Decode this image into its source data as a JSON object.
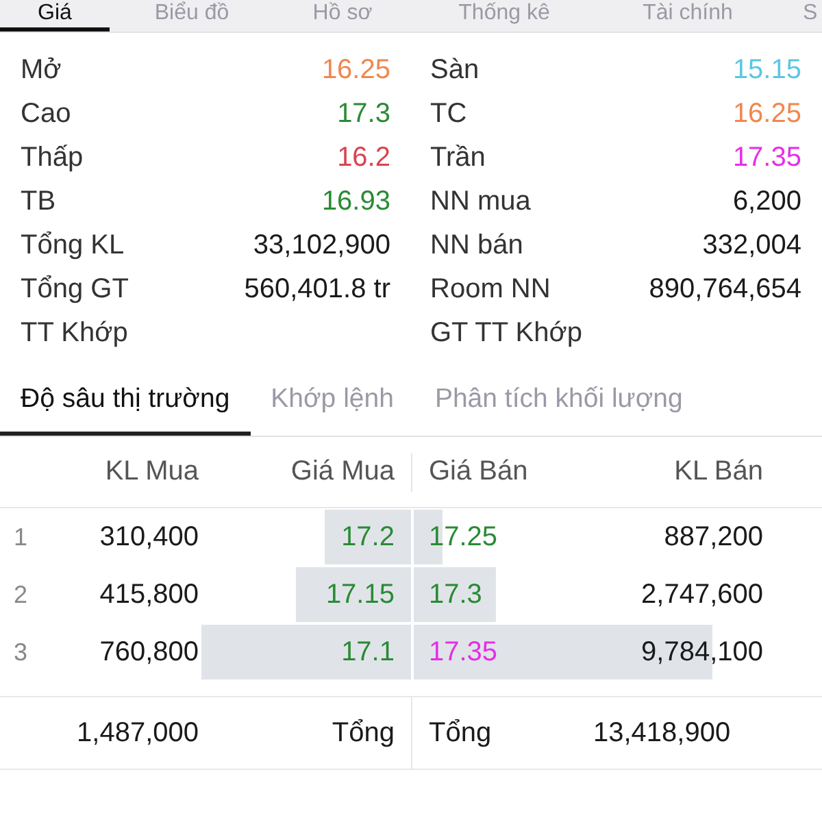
{
  "tabs": [
    {
      "label": "Giá",
      "selected": true
    },
    {
      "label": "Biểu đồ",
      "selected": false
    },
    {
      "label": "Hồ sơ",
      "selected": false
    },
    {
      "label": "Thống kê",
      "selected": false
    },
    {
      "label": "Tài chính",
      "selected": false
    },
    {
      "label": "S",
      "selected": false
    }
  ],
  "stats": {
    "left": [
      {
        "label": "Mở",
        "value": "16.25",
        "color": "#f0874f"
      },
      {
        "label": "Cao",
        "value": "17.3",
        "color": "#2a8a34"
      },
      {
        "label": "Thấp",
        "value": "16.2",
        "color": "#d9434f"
      },
      {
        "label": "TB",
        "value": "16.93",
        "color": "#2a8a34"
      },
      {
        "label": "Tổng KL",
        "value": "33,102,900",
        "color": "#1a1a1a"
      },
      {
        "label": "Tổng GT",
        "value": "560,401.8 tr",
        "color": "#1a1a1a"
      },
      {
        "label": "TT Khớp"
      }
    ],
    "right": [
      {
        "label": "Sàn",
        "value": "15.15",
        "color": "#5cc6e3"
      },
      {
        "label": "TC",
        "value": "16.25",
        "color": "#f0874f"
      },
      {
        "label": "Trần",
        "value": "17.35",
        "color": "#e62ee6"
      },
      {
        "label": "NN mua",
        "value": "6,200",
        "color": "#1a1a1a"
      },
      {
        "label": "NN bán",
        "value": "332,004",
        "color": "#1a1a1a"
      },
      {
        "label": "Room NN",
        "value": "890,764,654",
        "color": "#1a1a1a"
      },
      {
        "label": "GT TT Khớp"
      }
    ]
  },
  "depth_tabs": [
    {
      "label": "Độ sâu thị trường",
      "selected": true
    },
    {
      "label": "Khớp lệnh",
      "selected": false
    },
    {
      "label": "Phân tích khối lượng",
      "selected": false
    }
  ],
  "order_book": {
    "columns": [
      "KL Mua",
      "Giá Mua",
      "Giá Bán",
      "KL Bán"
    ],
    "rows": [
      {
        "number": "1",
        "bid": {
          "volume": "310,400",
          "price": "17.2",
          "color": "#2a8a34",
          "level": 0.21
        },
        "ask": {
          "price": "17.25",
          "color": "#2a8a34",
          "volume": "887,200",
          "level": 0.07
        }
      },
      {
        "number": "2",
        "bid": {
          "volume": "415,800",
          "price": "17.15",
          "color": "#2a8a34",
          "level": 0.28
        },
        "ask": {
          "price": "17.3",
          "color": "#2a8a34",
          "volume": "2,747,600",
          "level": 0.2
        }
      },
      {
        "number": "3",
        "bid": {
          "volume": "760,800",
          "price": "17.1",
          "color": "#2a8a34",
          "level": 0.51
        },
        "ask": {
          "price": "17.35",
          "color": "#e62ee6",
          "volume": "9,784,100",
          "level": 0.73
        }
      }
    ],
    "totals": {
      "bid_volume": "1,487,000",
      "bid_label": "Tổng",
      "ask_label": "Tổng",
      "ask_volume": "13,418,900"
    }
  }
}
